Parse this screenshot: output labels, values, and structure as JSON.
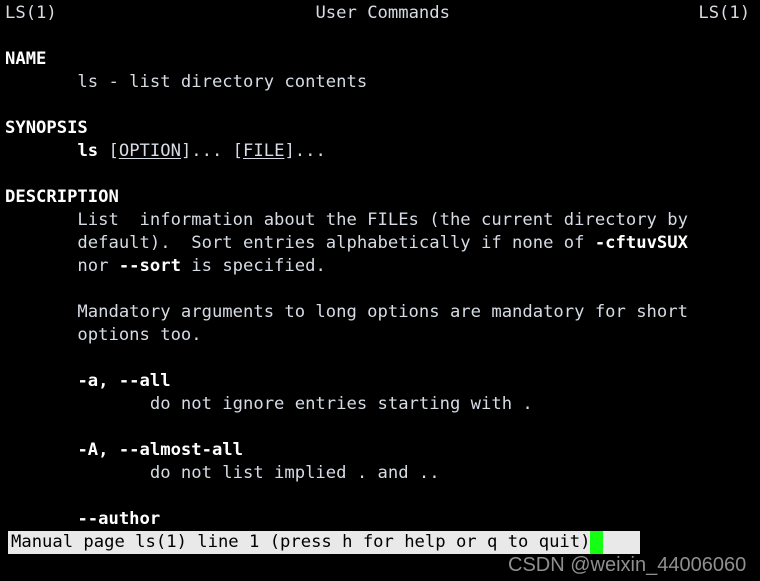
{
  "terminal": {
    "background_color": "#000000",
    "foreground_color": "#d6dbe4",
    "bold_color": "#ffffff",
    "cursor_color": "#15ff15",
    "columns": 67,
    "rows": 24
  },
  "man_page": {
    "header": {
      "left": "LS(1)",
      "center": "User Commands",
      "right": "LS(1)"
    },
    "sections": [
      {
        "name": "NAME",
        "heading": "NAME",
        "body": [
          "      ls - list directory contents"
        ]
      },
      {
        "name": "SYNOPSIS",
        "heading": "SYNOPSIS",
        "body": [
          "      ls [OPTION]... [FILE]..."
        ]
      },
      {
        "name": "DESCRIPTION",
        "heading": "DESCRIPTION",
        "body": [
          "      List  information about the FILEs (the current directory by",
          "      default).  Sort entries alphabetically if none of -cftuvSUX",
          "      nor --sort is specified.",
          "",
          "      Mandatory arguments to long options are mandatory for short",
          "      options too.",
          "",
          "      -a, --all",
          "             do not ignore entries starting with .",
          "",
          "      -A, --almost-all",
          "             do not list implied . and ..",
          "",
          "      --author"
        ]
      }
    ],
    "lines": [
      {
        "id": "header-line",
        "runs": [
          {
            "text": "LS(1)",
            "style": "plain"
          },
          {
            "text": "                         ",
            "style": "plain"
          },
          {
            "text": "User Commands",
            "style": "plain"
          },
          {
            "text": "                        ",
            "style": "plain"
          },
          {
            "text": "LS(1)",
            "style": "plain"
          }
        ]
      },
      {
        "id": "blank-1",
        "runs": [
          {
            "text": "",
            "style": "plain"
          }
        ]
      },
      {
        "id": "heading-name",
        "runs": [
          {
            "text": "NAME",
            "style": "bold"
          }
        ]
      },
      {
        "id": "name-body",
        "runs": [
          {
            "text": "       ls - list directory contents",
            "style": "plain"
          }
        ]
      },
      {
        "id": "blank-2",
        "runs": [
          {
            "text": "",
            "style": "plain"
          }
        ]
      },
      {
        "id": "heading-synopsis",
        "runs": [
          {
            "text": "SYNOPSIS",
            "style": "bold"
          }
        ]
      },
      {
        "id": "synopsis-body",
        "runs": [
          {
            "text": "       ",
            "style": "plain"
          },
          {
            "text": "ls",
            "style": "bold"
          },
          {
            "text": " [",
            "style": "plain"
          },
          {
            "text": "OPTION",
            "style": "underline"
          },
          {
            "text": "]... [",
            "style": "plain"
          },
          {
            "text": "FILE",
            "style": "underline"
          },
          {
            "text": "]...",
            "style": "plain"
          }
        ]
      },
      {
        "id": "blank-3",
        "runs": [
          {
            "text": "",
            "style": "plain"
          }
        ]
      },
      {
        "id": "heading-description",
        "runs": [
          {
            "text": "DESCRIPTION",
            "style": "bold"
          }
        ]
      },
      {
        "id": "description-line-1",
        "runs": [
          {
            "text": "       List  information about the FILEs (the current directory by",
            "style": "plain"
          }
        ]
      },
      {
        "id": "description-line-2",
        "runs": [
          {
            "text": "       default).  Sort entries alphabetically if none of ",
            "style": "plain"
          },
          {
            "text": "-cftuvSUX",
            "style": "bold"
          }
        ]
      },
      {
        "id": "description-line-3",
        "runs": [
          {
            "text": "       nor ",
            "style": "plain"
          },
          {
            "text": "--sort",
            "style": "bold"
          },
          {
            "text": " is specified.",
            "style": "plain"
          }
        ]
      },
      {
        "id": "blank-4",
        "runs": [
          {
            "text": "",
            "style": "plain"
          }
        ]
      },
      {
        "id": "mandatory-line-1",
        "runs": [
          {
            "text": "       Mandatory arguments to long options are mandatory for short",
            "style": "plain"
          }
        ]
      },
      {
        "id": "mandatory-line-2",
        "runs": [
          {
            "text": "       options too.",
            "style": "plain"
          }
        ]
      },
      {
        "id": "blank-5",
        "runs": [
          {
            "text": "",
            "style": "plain"
          }
        ]
      },
      {
        "id": "option-all-flag",
        "runs": [
          {
            "text": "       ",
            "style": "plain"
          },
          {
            "text": "-a, --all",
            "style": "bold"
          }
        ]
      },
      {
        "id": "option-all-desc",
        "runs": [
          {
            "text": "              do not ignore entries starting with .",
            "style": "plain"
          }
        ]
      },
      {
        "id": "blank-6",
        "runs": [
          {
            "text": "",
            "style": "plain"
          }
        ]
      },
      {
        "id": "option-almost-all-flag",
        "runs": [
          {
            "text": "       ",
            "style": "plain"
          },
          {
            "text": "-A, --almost-all",
            "style": "bold"
          }
        ]
      },
      {
        "id": "option-almost-all-desc",
        "runs": [
          {
            "text": "              do not list implied . and ..",
            "style": "plain"
          }
        ]
      },
      {
        "id": "blank-7",
        "runs": [
          {
            "text": "",
            "style": "plain"
          }
        ]
      },
      {
        "id": "option-author-flag",
        "runs": [
          {
            "text": "       ",
            "style": "plain"
          },
          {
            "text": "--author",
            "style": "bold"
          }
        ]
      }
    ]
  },
  "status_bar": {
    "text": "Manual page ls(1) line 1 (press h for help or q to quit)",
    "background_color": "#e9e9e9",
    "text_color": "#000000",
    "cursor": {
      "visible": true,
      "color": "#15ff15"
    }
  },
  "watermark": {
    "text": "CSDN @weixin_44006060",
    "color": "#8f8f8f"
  }
}
